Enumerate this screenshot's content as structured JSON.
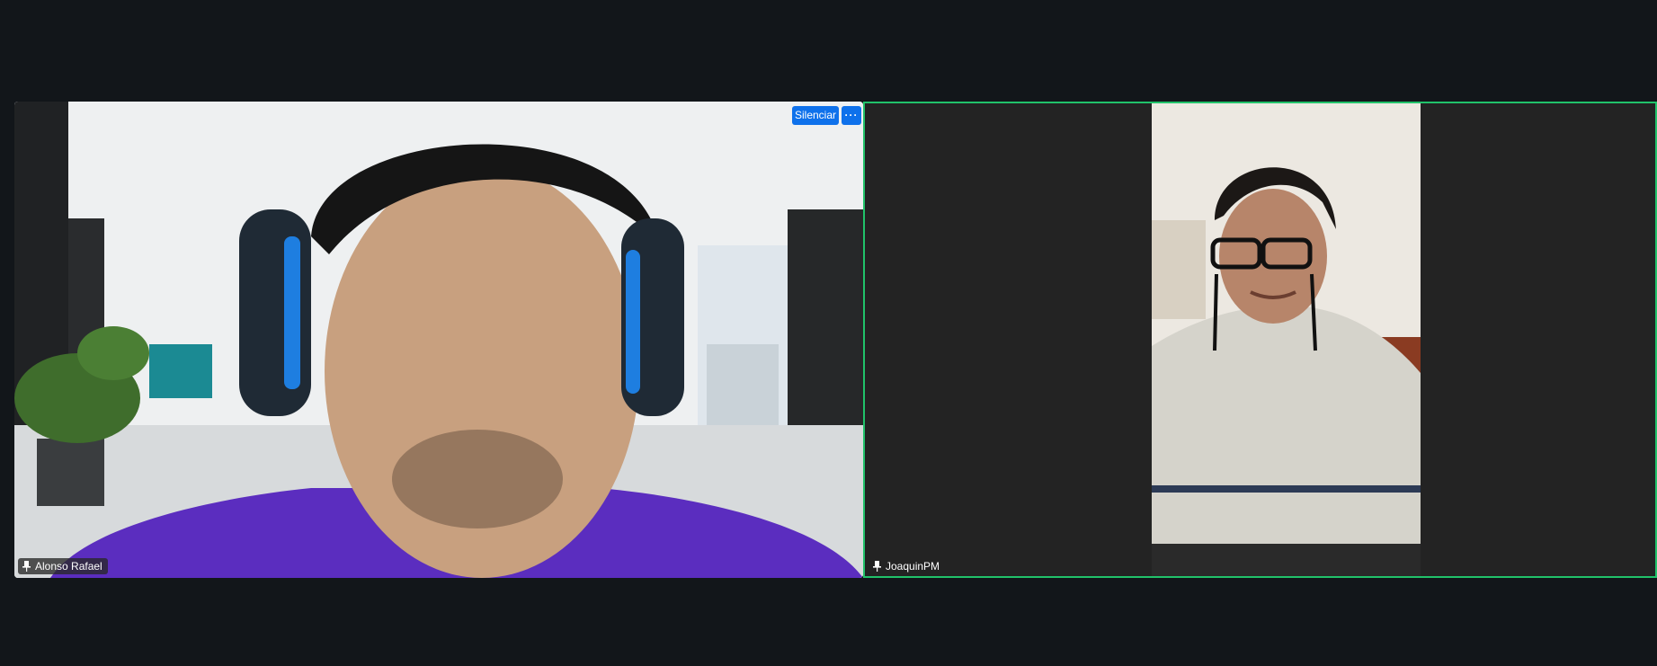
{
  "participants": [
    {
      "name": "Alonso Rafael",
      "icon": "pin-icon",
      "controls": {
        "mute_label": "Silenciar",
        "more_label": "···"
      }
    },
    {
      "name": "JoaquinPM",
      "icon": "pin-icon",
      "active_speaker": true
    }
  ],
  "colors": {
    "background": "#12161a",
    "active_speaker_border": "#21c26a",
    "button_blue": "#0e71eb"
  }
}
